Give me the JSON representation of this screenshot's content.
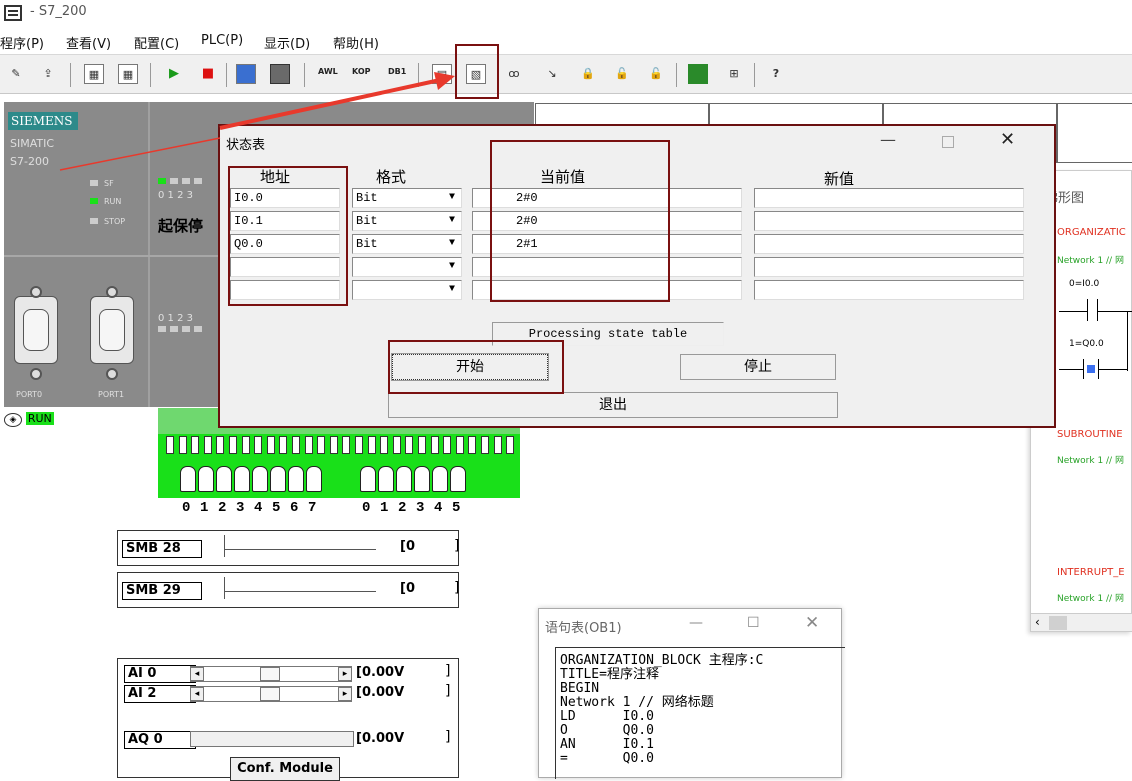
{
  "window": {
    "title": "- S7_200"
  },
  "menu": [
    "程序(P)",
    "查看(V)",
    "配置(C)",
    "PLC(P)",
    "显示(D)",
    "帮助(H)"
  ],
  "toolbar": {
    "awl_label": "AWL",
    "kop_label": "KOP",
    "db1_label": "DB1"
  },
  "plc": {
    "brand": "SIEMENS",
    "model_line1": "SIMATIC",
    "model_line2": "S7-200",
    "status_labels": [
      "SF",
      "RUN",
      "STOP"
    ],
    "input_digits": "0 1 2 3",
    "output_digits": "0 1 2 3",
    "program_name": "起保停",
    "port0": "PORT0",
    "port1": "PORT1",
    "run_badge": "RUN"
  },
  "switch_numbers": [
    "0",
    "1",
    "2",
    "3",
    "4",
    "5",
    "6",
    "7",
    "0",
    "1",
    "2",
    "3",
    "4",
    "5"
  ],
  "smb": [
    {
      "label": "SMB 28",
      "value": "0"
    },
    {
      "label": "SMB 29",
      "value": "0"
    }
  ],
  "analog": {
    "ai": [
      {
        "label": "AI 0",
        "value": "0.00V"
      },
      {
        "label": "AI 2",
        "value": "0.00V"
      }
    ],
    "aq": {
      "label": "AQ 0",
      "value": "0.00V"
    },
    "conf_button": "Conf. Module"
  },
  "ladder": {
    "title": "梯形图",
    "org_block": "ORGANIZATIC",
    "network1": "Network 1 // 网",
    "contact1": "0=I0.0",
    "coil1": "1=Q0.0",
    "subroutine": "SUBROUTINE",
    "network1b": "Network 1 // 网",
    "interrupt": "INTERRUPT_E",
    "network1c": "Network 1 // 网"
  },
  "stl": {
    "title": "语句表(OB1)",
    "lines": [
      "ORGANIZATION_BLOCK 主程序:C",
      "TITLE=程序注释",
      "BEGIN",
      "Network 1 // 网络标题",
      "LD      I0.0",
      "O       Q0.0",
      "AN      I0.1",
      "=       Q0.0"
    ]
  },
  "status_table": {
    "title": "状态表",
    "headers": {
      "address": "地址",
      "format": "格式",
      "current": "当前值",
      "new": "新值"
    },
    "rows": [
      {
        "address": "I0.0",
        "format": "Bit",
        "current": "2#0",
        "new": ""
      },
      {
        "address": "I0.1",
        "format": "Bit",
        "current": "2#0",
        "new": ""
      },
      {
        "address": "Q0.0",
        "format": "Bit",
        "current": "2#1",
        "new": ""
      },
      {
        "address": "",
        "format": "",
        "current": "",
        "new": ""
      },
      {
        "address": "",
        "format": "",
        "current": "",
        "new": ""
      }
    ],
    "status_text": "Processing state table",
    "start_button": "开始",
    "stop_button": "停止",
    "exit_button": "退出"
  },
  "colors": {
    "highlight": "#7a1010",
    "arrow": "#e8392c",
    "led_green": "#19e019"
  }
}
